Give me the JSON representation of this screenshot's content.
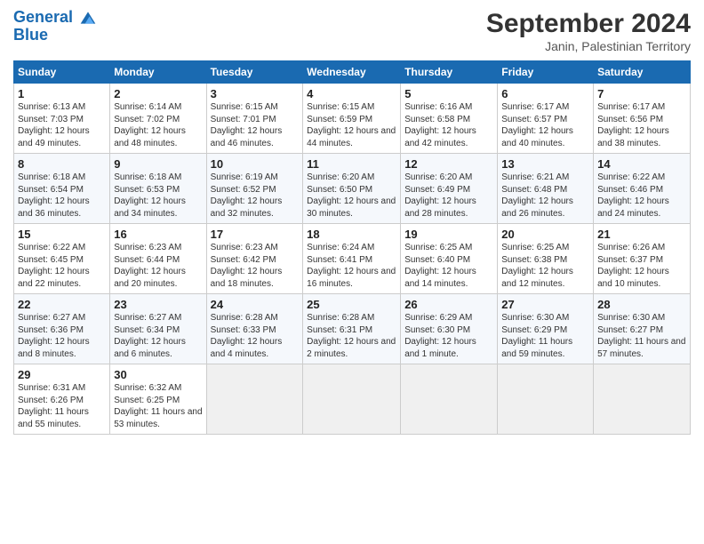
{
  "header": {
    "logo_line1": "General",
    "logo_line2": "Blue",
    "month": "September 2024",
    "location": "Janin, Palestinian Territory"
  },
  "days_of_week": [
    "Sunday",
    "Monday",
    "Tuesday",
    "Wednesday",
    "Thursday",
    "Friday",
    "Saturday"
  ],
  "weeks": [
    [
      {
        "num": "1",
        "rise": "6:13 AM",
        "set": "7:03 PM",
        "daylight": "12 hours and 49 minutes."
      },
      {
        "num": "2",
        "rise": "6:14 AM",
        "set": "7:02 PM",
        "daylight": "12 hours and 48 minutes."
      },
      {
        "num": "3",
        "rise": "6:15 AM",
        "set": "7:01 PM",
        "daylight": "12 hours and 46 minutes."
      },
      {
        "num": "4",
        "rise": "6:15 AM",
        "set": "6:59 PM",
        "daylight": "12 hours and 44 minutes."
      },
      {
        "num": "5",
        "rise": "6:16 AM",
        "set": "6:58 PM",
        "daylight": "12 hours and 42 minutes."
      },
      {
        "num": "6",
        "rise": "6:17 AM",
        "set": "6:57 PM",
        "daylight": "12 hours and 40 minutes."
      },
      {
        "num": "7",
        "rise": "6:17 AM",
        "set": "6:56 PM",
        "daylight": "12 hours and 38 minutes."
      }
    ],
    [
      {
        "num": "8",
        "rise": "6:18 AM",
        "set": "6:54 PM",
        "daylight": "12 hours and 36 minutes."
      },
      {
        "num": "9",
        "rise": "6:18 AM",
        "set": "6:53 PM",
        "daylight": "12 hours and 34 minutes."
      },
      {
        "num": "10",
        "rise": "6:19 AM",
        "set": "6:52 PM",
        "daylight": "12 hours and 32 minutes."
      },
      {
        "num": "11",
        "rise": "6:20 AM",
        "set": "6:50 PM",
        "daylight": "12 hours and 30 minutes."
      },
      {
        "num": "12",
        "rise": "6:20 AM",
        "set": "6:49 PM",
        "daylight": "12 hours and 28 minutes."
      },
      {
        "num": "13",
        "rise": "6:21 AM",
        "set": "6:48 PM",
        "daylight": "12 hours and 26 minutes."
      },
      {
        "num": "14",
        "rise": "6:22 AM",
        "set": "6:46 PM",
        "daylight": "12 hours and 24 minutes."
      }
    ],
    [
      {
        "num": "15",
        "rise": "6:22 AM",
        "set": "6:45 PM",
        "daylight": "12 hours and 22 minutes."
      },
      {
        "num": "16",
        "rise": "6:23 AM",
        "set": "6:44 PM",
        "daylight": "12 hours and 20 minutes."
      },
      {
        "num": "17",
        "rise": "6:23 AM",
        "set": "6:42 PM",
        "daylight": "12 hours and 18 minutes."
      },
      {
        "num": "18",
        "rise": "6:24 AM",
        "set": "6:41 PM",
        "daylight": "12 hours and 16 minutes."
      },
      {
        "num": "19",
        "rise": "6:25 AM",
        "set": "6:40 PM",
        "daylight": "12 hours and 14 minutes."
      },
      {
        "num": "20",
        "rise": "6:25 AM",
        "set": "6:38 PM",
        "daylight": "12 hours and 12 minutes."
      },
      {
        "num": "21",
        "rise": "6:26 AM",
        "set": "6:37 PM",
        "daylight": "12 hours and 10 minutes."
      }
    ],
    [
      {
        "num": "22",
        "rise": "6:27 AM",
        "set": "6:36 PM",
        "daylight": "12 hours and 8 minutes."
      },
      {
        "num": "23",
        "rise": "6:27 AM",
        "set": "6:34 PM",
        "daylight": "12 hours and 6 minutes."
      },
      {
        "num": "24",
        "rise": "6:28 AM",
        "set": "6:33 PM",
        "daylight": "12 hours and 4 minutes."
      },
      {
        "num": "25",
        "rise": "6:28 AM",
        "set": "6:31 PM",
        "daylight": "12 hours and 2 minutes."
      },
      {
        "num": "26",
        "rise": "6:29 AM",
        "set": "6:30 PM",
        "daylight": "12 hours and 1 minute."
      },
      {
        "num": "27",
        "rise": "6:30 AM",
        "set": "6:29 PM",
        "daylight": "11 hours and 59 minutes."
      },
      {
        "num": "28",
        "rise": "6:30 AM",
        "set": "6:27 PM",
        "daylight": "11 hours and 57 minutes."
      }
    ],
    [
      {
        "num": "29",
        "rise": "6:31 AM",
        "set": "6:26 PM",
        "daylight": "11 hours and 55 minutes."
      },
      {
        "num": "30",
        "rise": "6:32 AM",
        "set": "6:25 PM",
        "daylight": "11 hours and 53 minutes."
      },
      null,
      null,
      null,
      null,
      null
    ]
  ]
}
